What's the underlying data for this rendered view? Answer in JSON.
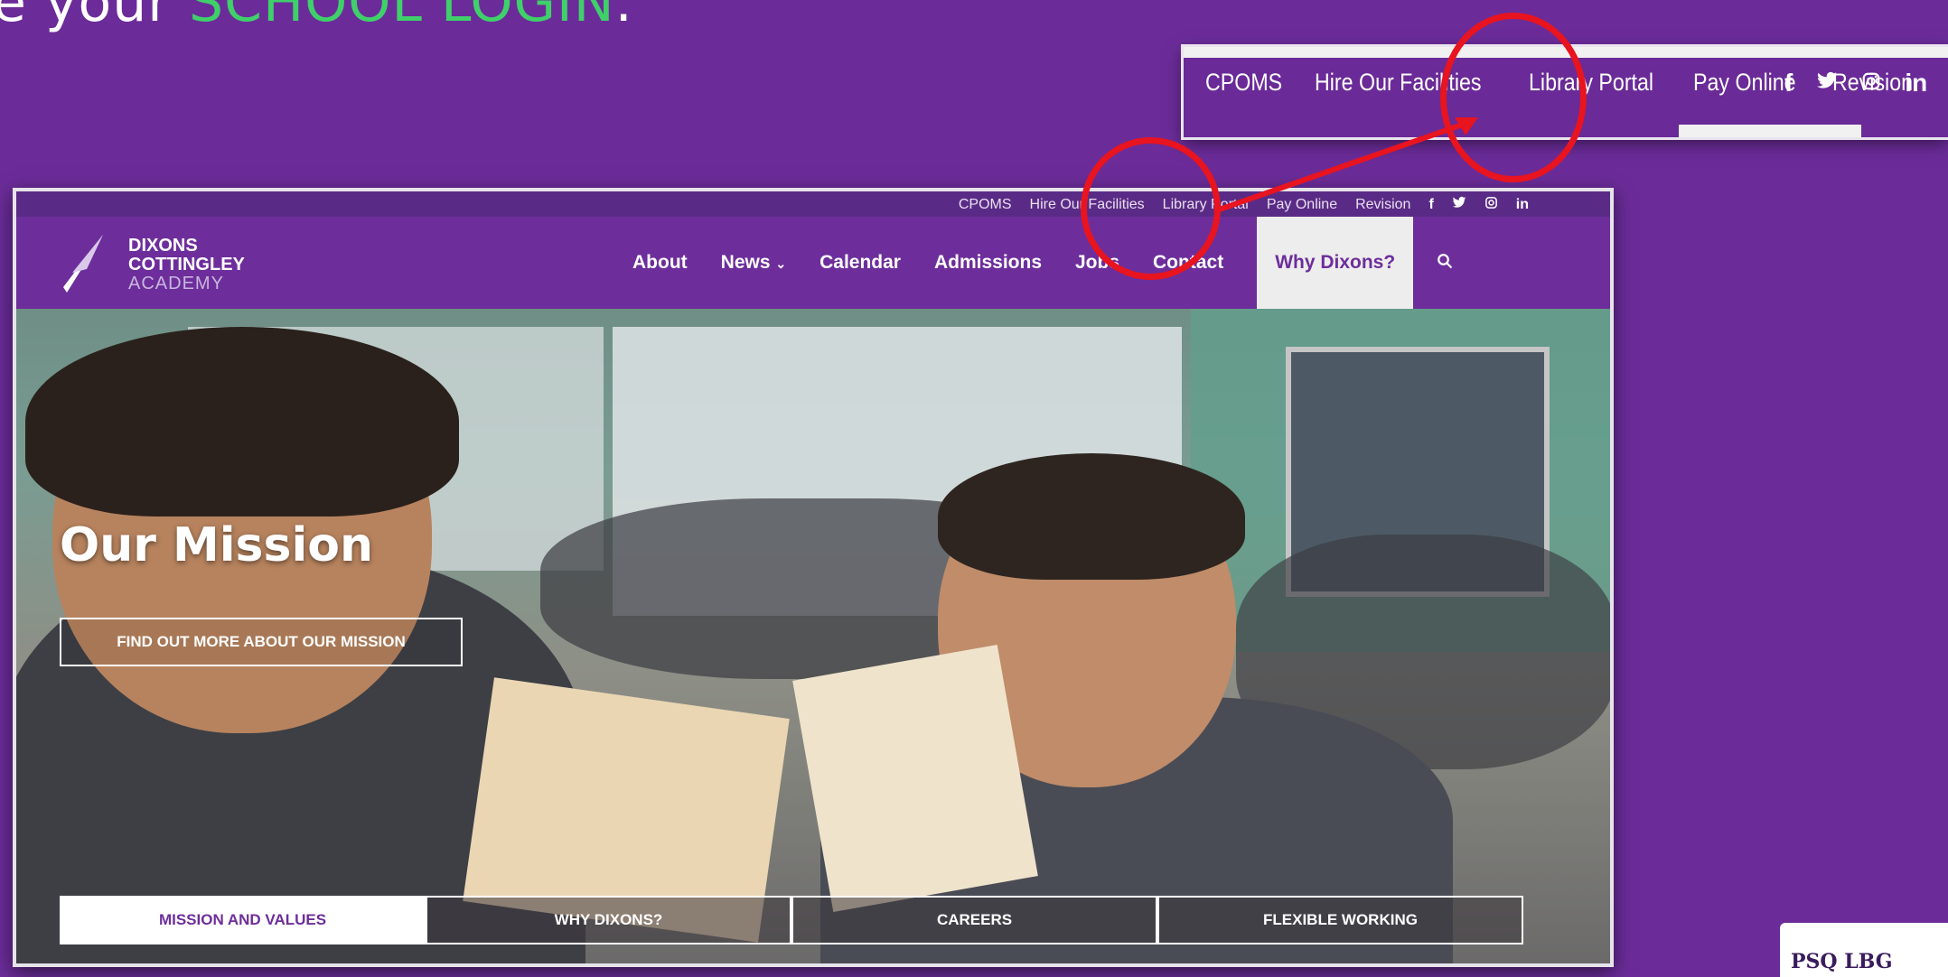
{
  "instruction": {
    "prefix": "e your ",
    "highlight": "SCHOOL LOGIN",
    "suffix": "."
  },
  "zoom_nav": {
    "items": [
      "CPOMS",
      "Hire Our Facilities",
      "Library Portal",
      "Pay Online",
      "Revision"
    ],
    "icons": [
      "facebook-icon",
      "twitter-icon",
      "instagram-icon",
      "linkedin-icon"
    ]
  },
  "site": {
    "topbar": {
      "items": [
        "CPOMS",
        "Hire Our Facilities",
        "Library Portal",
        "Pay Online",
        "Revision"
      ]
    },
    "logo": {
      "line1": "DIXONS",
      "line2": "COTTINGLEY",
      "line3": "ACADEMY"
    },
    "menu": [
      "About",
      "News",
      "Calendar",
      "Admissions",
      "Jobs",
      "Contact",
      "Why Dixons?"
    ],
    "hero": {
      "title": "Our Mission",
      "button": "FIND OUT MORE ABOUT OUR MISSION"
    },
    "tabs": [
      "MISSION AND VALUES",
      "WHY DIXONS?",
      "CAREERS",
      "FLEXIBLE WORKING"
    ]
  },
  "colors": {
    "background": "#6b2c99",
    "highlight": "#3fd06a",
    "annotation": "#e8141f",
    "menu_active_bg": "#ededed"
  },
  "corner_label": "PSQ LBG"
}
